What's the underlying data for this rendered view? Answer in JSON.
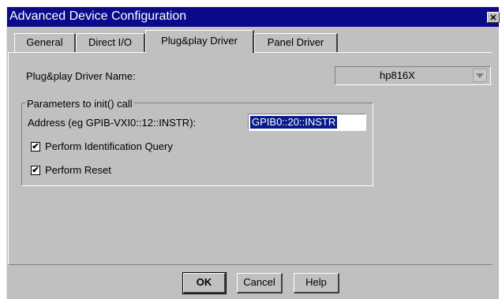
{
  "window": {
    "title": "Advanced Device Configuration",
    "close_glyph": "✕"
  },
  "tabs": [
    {
      "label": "General",
      "active": false
    },
    {
      "label": "Direct I/O",
      "active": false
    },
    {
      "label": "Plug&play Driver",
      "active": true
    },
    {
      "label": "Panel Driver",
      "active": false
    }
  ],
  "driver": {
    "name_label": "Plug&play Driver Name:",
    "name_value": "hp816X"
  },
  "init_params": {
    "group_title": "Parameters to init() call",
    "address_label": "Address (eg GPIB-VXI0::12::INSTR):",
    "address_value": "GPIB0::20::INSTR",
    "id_query_label": "Perform Identification Query",
    "id_query_checked": true,
    "reset_label": "Perform Reset",
    "reset_checked": true,
    "check_glyph": "✔"
  },
  "buttons": {
    "ok": "OK",
    "cancel": "Cancel",
    "help": "Help"
  },
  "colors": {
    "titlebar": "#0a0a8a",
    "dialog_bg": "#c0c0c0",
    "selection": "#0a1a8c"
  },
  "icons": {
    "close": "close-icon",
    "dropdown": "chevron-down-icon",
    "check": "check-icon"
  }
}
